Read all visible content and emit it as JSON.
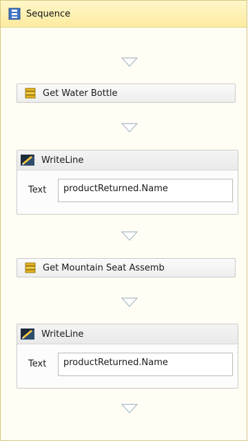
{
  "sequence": {
    "title": "Sequence",
    "icon": "sequence-icon"
  },
  "activities": [
    {
      "type": "activity",
      "label": "Get Water Bottle",
      "icon": "activity-icon"
    },
    {
      "type": "writeline",
      "label": "WriteLine",
      "icon": "writeline-icon",
      "property": {
        "label": "Text",
        "value": "productReturned.Name"
      }
    },
    {
      "type": "activity",
      "label": "Get Mountain Seat Assemb",
      "icon": "activity-icon"
    },
    {
      "type": "writeline",
      "label": "WriteLine",
      "icon": "writeline-icon",
      "property": {
        "label": "Text",
        "value": "productReturned.Name"
      }
    }
  ],
  "colors": {
    "header_bg": "#fdeba0",
    "header_border": "#d7c77f",
    "activity_border": "#c9c9c9",
    "drop_arrow": "#a9b7c6"
  }
}
